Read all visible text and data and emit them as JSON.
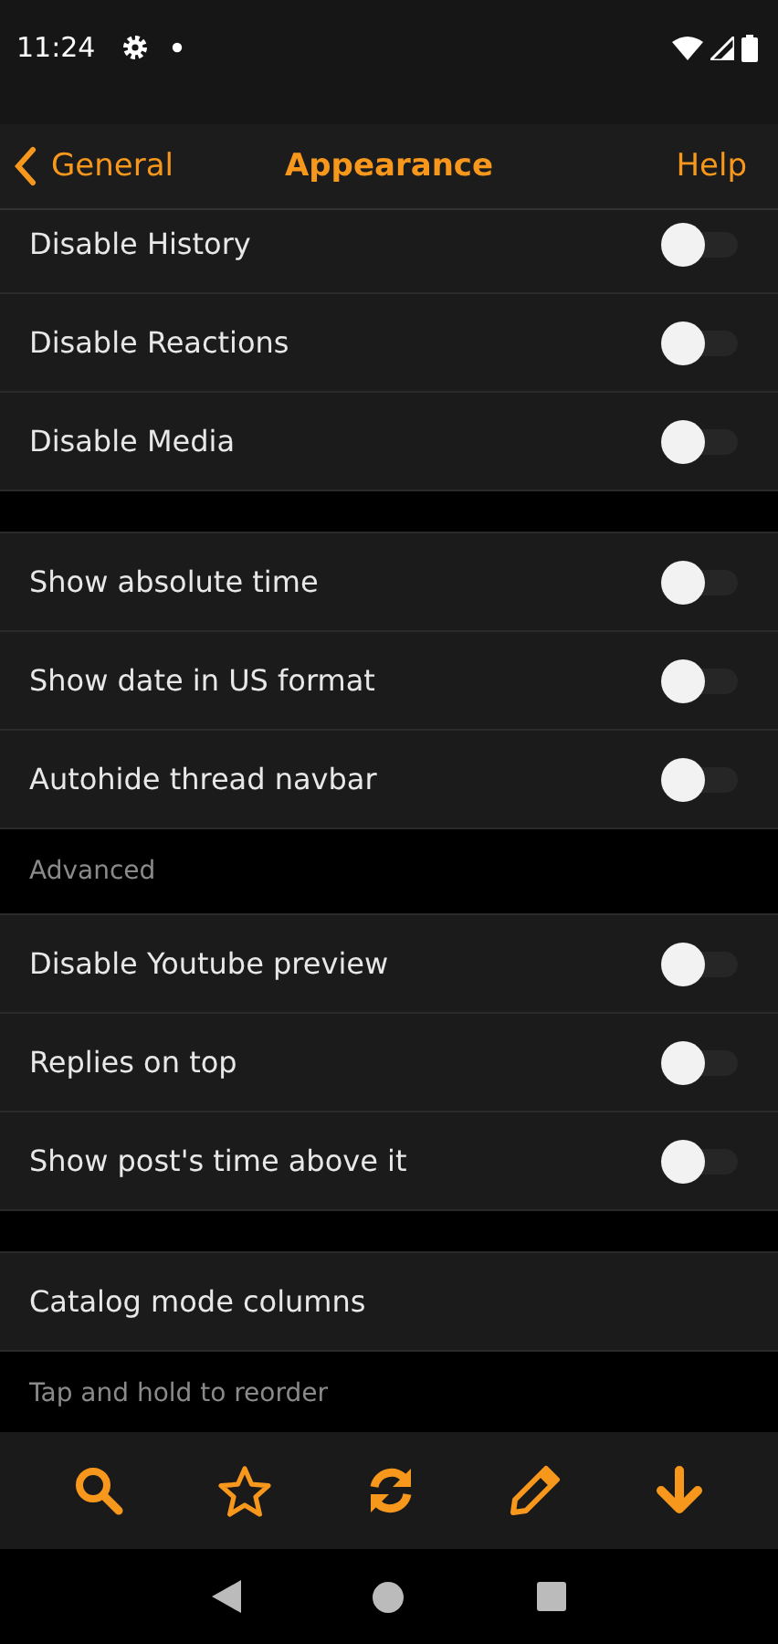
{
  "status_bar": {
    "time": "11:24"
  },
  "header": {
    "back": "General",
    "title": "Appearance",
    "action": "Help"
  },
  "sections": [
    {
      "kind": "group",
      "rows": [
        {
          "label": "Disable History",
          "kind": "toggle",
          "on": false
        },
        {
          "label": "Disable Reactions",
          "kind": "toggle",
          "on": false
        },
        {
          "label": "Disable Media",
          "kind": "toggle",
          "on": false
        }
      ]
    },
    {
      "kind": "spacer"
    },
    {
      "kind": "group",
      "rows": [
        {
          "label": "Show absolute time",
          "kind": "toggle",
          "on": false
        },
        {
          "label": "Show date in US format",
          "kind": "toggle",
          "on": false
        },
        {
          "label": "Autohide thread navbar",
          "kind": "toggle",
          "on": false
        }
      ]
    },
    {
      "kind": "header",
      "label": "Advanced"
    },
    {
      "kind": "group",
      "rows": [
        {
          "label": "Disable Youtube preview",
          "kind": "toggle",
          "on": false
        },
        {
          "label": "Replies on top",
          "kind": "toggle",
          "on": false
        },
        {
          "label": "Show post's time above it",
          "kind": "toggle",
          "on": false
        }
      ]
    },
    {
      "kind": "spacer"
    },
    {
      "kind": "group",
      "rows": [
        {
          "label": "Catalog mode columns",
          "kind": "plain"
        }
      ]
    },
    {
      "kind": "header",
      "label": "Tap and hold to reorder"
    }
  ]
}
